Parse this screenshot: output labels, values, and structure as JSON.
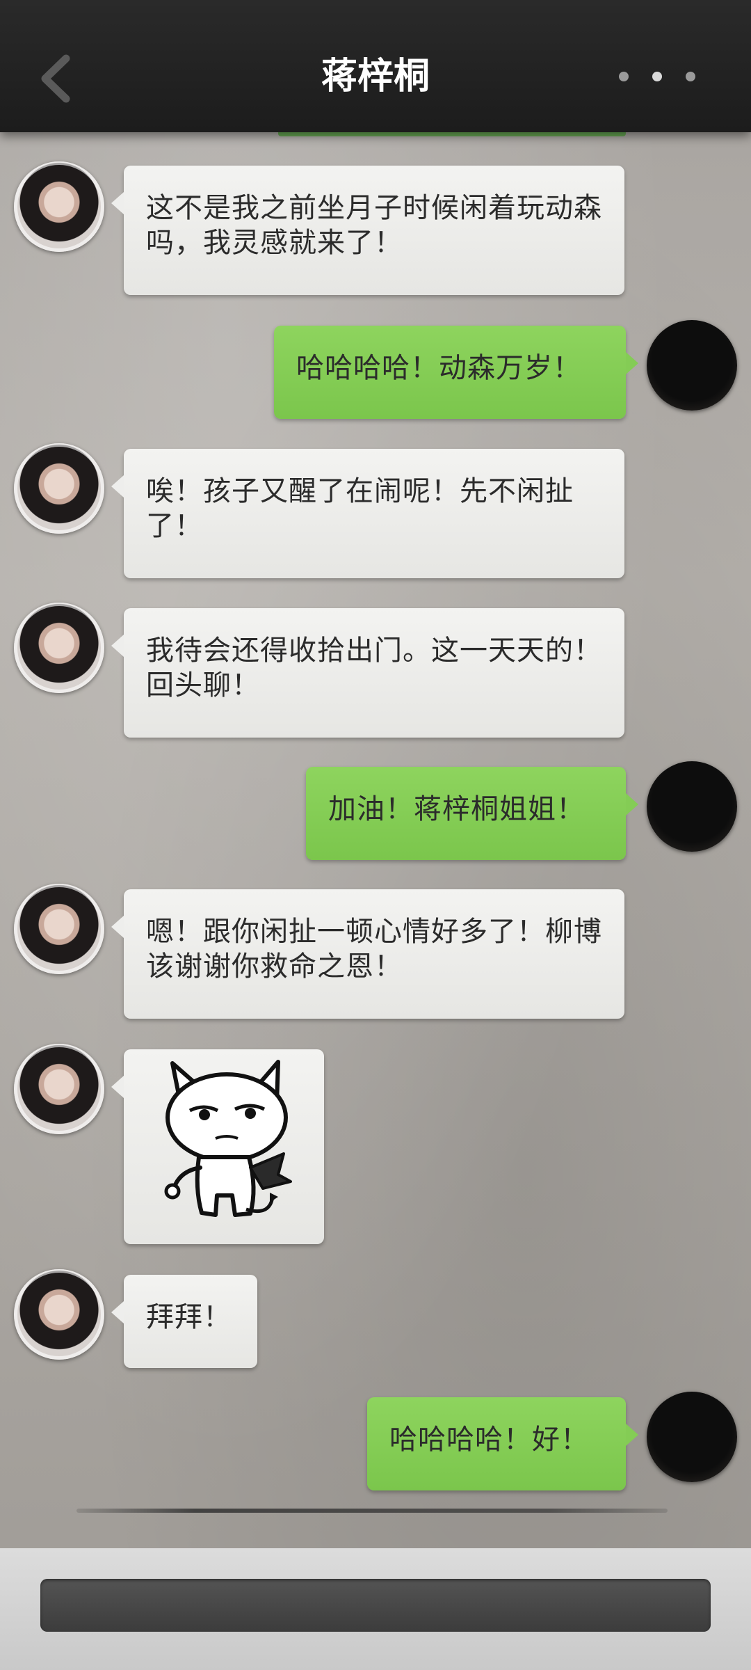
{
  "header": {
    "title": "蒋梓桐"
  },
  "messages": [
    {
      "sender": "her",
      "text": "这不是我之前坐月子时候闲着玩动森吗，我灵感就来了！"
    },
    {
      "sender": "me",
      "text": "哈哈哈哈！动森万岁！"
    },
    {
      "sender": "her",
      "text": "唉！孩子又醒了在闹呢！先不闲扯了！"
    },
    {
      "sender": "her",
      "text": "我待会还得收拾出门。这一天天的！回头聊！"
    },
    {
      "sender": "me",
      "text": "加油！蒋梓桐姐姐！"
    },
    {
      "sender": "her",
      "text": "嗯！跟你闲扯一顿心情好多了！柳博该谢谢你救命之恩！"
    },
    {
      "sender": "her",
      "type": "sticker",
      "sticker": "devil-cat-sticker"
    },
    {
      "sender": "her",
      "text": "拜拜！"
    },
    {
      "sender": "me",
      "text": "哈哈哈哈！好！"
    }
  ],
  "input": {
    "value": ""
  },
  "colors": {
    "topbar": "#1f1f1f",
    "my_bubble": "#84cc55",
    "her_bubble": "#eeeeec"
  },
  "icons": {
    "back": "chevron-left-icon",
    "more": "more-dots-icon"
  }
}
